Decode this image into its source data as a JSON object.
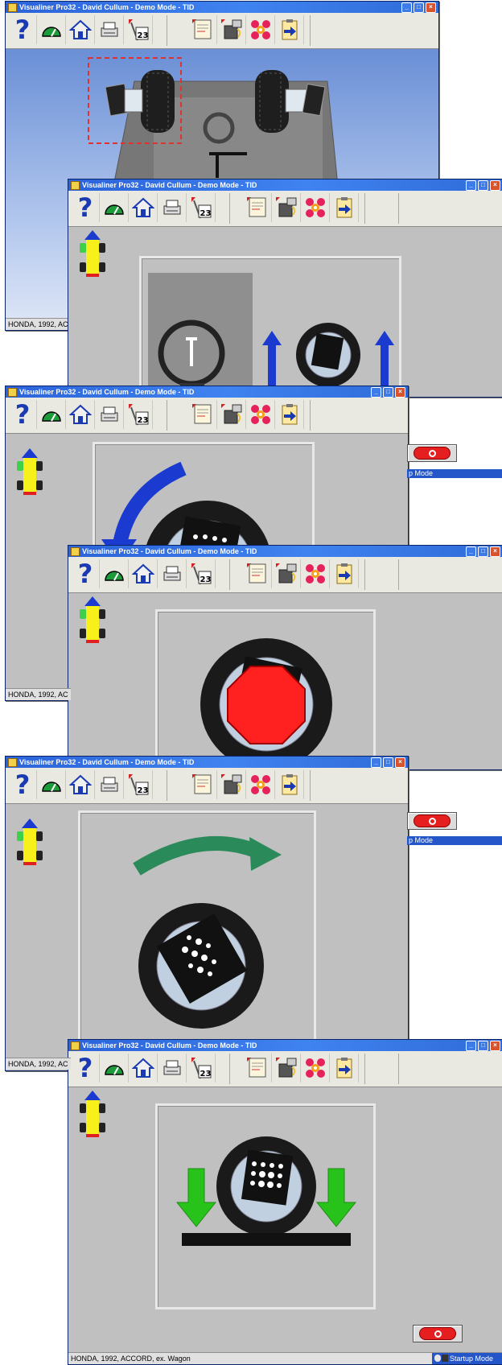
{
  "window_title": "Visualiner Pro32 - David Cullum - Demo Mode  -  TID",
  "window_controls": {
    "minimize": "_",
    "maximize": "□",
    "close": "×"
  },
  "toolbar": {
    "help_icon": "?",
    "tools": [
      "help-icon",
      "gauge-icon",
      "home-icon",
      "printer-icon",
      "calendar-icon",
      "report-icon",
      "camera-icon",
      "targets-icon",
      "clipboard-icon"
    ],
    "calendar_day": "23"
  },
  "vehicle": {
    "status_short": "HONDA, 1992, AC",
    "status_full": "HONDA, 1992, ACCORD, ex. Wagon"
  },
  "mode_status": {
    "short": "p Mode",
    "full": "Startup Mode"
  },
  "colors": {
    "titlebar": "#2b63d9",
    "toolbar_bg": "#e9e9e2",
    "window_bg": "#c0c0c0",
    "arrow_blue": "#1a3ad0",
    "arrow_green_ccw": "#2a8a5a",
    "arrow_green_down": "#27c21a",
    "stop_red": "#e51f1f",
    "octagon_red": "#ff2020",
    "car_yellow": "#f7f01a"
  }
}
